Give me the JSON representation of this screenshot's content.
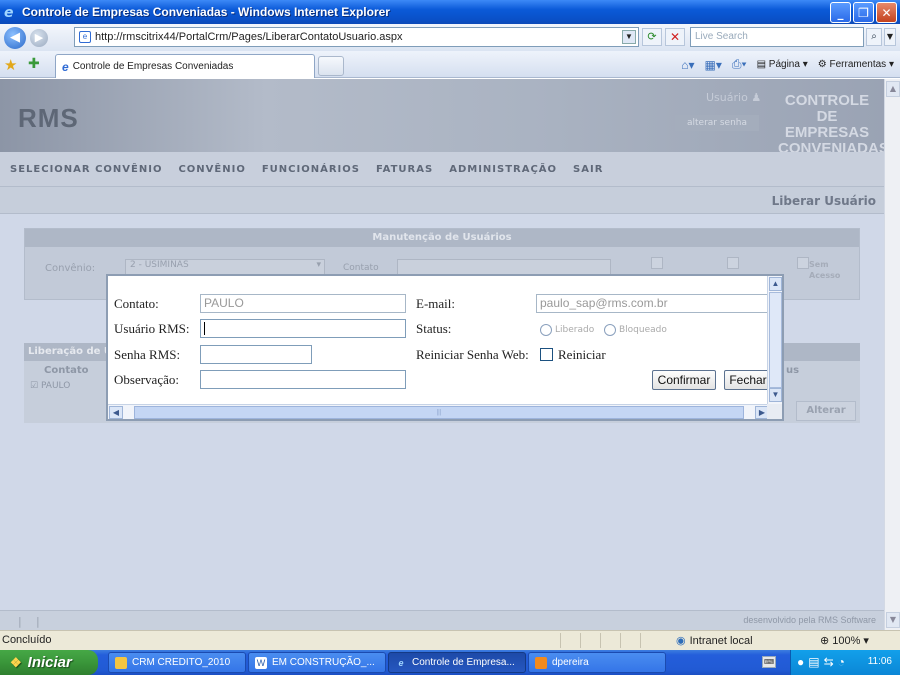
{
  "window": {
    "title": "Controle de Empresas Conveniadas - Windows Internet Explorer"
  },
  "addressbar": {
    "url": "http://rmscitrix44/PortalCrm/Pages/LiberarContatoUsuario.aspx",
    "search_placeholder": "Live Search"
  },
  "tabs": [
    {
      "label": "Controle de Empresas Conveniadas"
    }
  ],
  "commandbar": {
    "page_label": "Página",
    "tools_label": "Ferramentas"
  },
  "app": {
    "logo": "RMS",
    "user_label": "Usuário",
    "change_password": "alterar senha",
    "brand_line1": "CONTROLE",
    "brand_line2": "DE EMPRESAS",
    "brand_line3": "CONVENIADAS",
    "menu": [
      "SELECIONAR CONVÊNIO",
      "CONVÊNIO",
      "FUNCIONÁRIOS",
      "FATURAS",
      "ADMINISTRAÇÃO",
      "SAIR"
    ],
    "page_title": "Liberar Usuário",
    "manutencao": {
      "header": "Manutenção de Usuários",
      "convenio_label": "Convênio:",
      "convenio_value": "2 - USIMINAS",
      "contato_label": "Contato",
      "sem_acesso": "Sem Acesso"
    },
    "liberacao": {
      "header": "Liberação de Us",
      "col_contato": "Contato",
      "col_status": "us",
      "rows": [
        {
          "contato": "PAULO"
        }
      ],
      "alterar": "Alterar"
    },
    "footer_credit": "desenvolvido pela RMS Software"
  },
  "modal": {
    "contato_label": "Contato:",
    "contato_value": "PAULO",
    "email_label": "E-mail:",
    "email_value": "paulo_sap@rms.com.br",
    "usuario_label": "Usuário RMS:",
    "usuario_value": "",
    "status_label": "Status:",
    "status_options": [
      "Liberado",
      "Bloqueado"
    ],
    "senha_label": "Senha RMS:",
    "senha_value": "",
    "reiniciar_label": "Reiniciar Senha Web:",
    "reiniciar_option": "Reiniciar",
    "observacao_label": "Observação:",
    "observacao_value": "",
    "confirmar": "Confirmar",
    "fechar": "Fechar"
  },
  "statusbar": {
    "status": "Concluído",
    "zone": "Intranet local",
    "zoom": "100%"
  },
  "taskbar": {
    "start": "Iniciar",
    "items": [
      "CRM CREDITO_2010",
      "EM CONSTRUÇÃO_...",
      "Controle de Empresa...",
      "dpereira"
    ],
    "time": "11:06"
  },
  "colors": {
    "titlebar": "#0b5ad8",
    "page_bg": "#d0d8e8",
    "taskbar": "#245edb",
    "start": "#3a963a"
  }
}
